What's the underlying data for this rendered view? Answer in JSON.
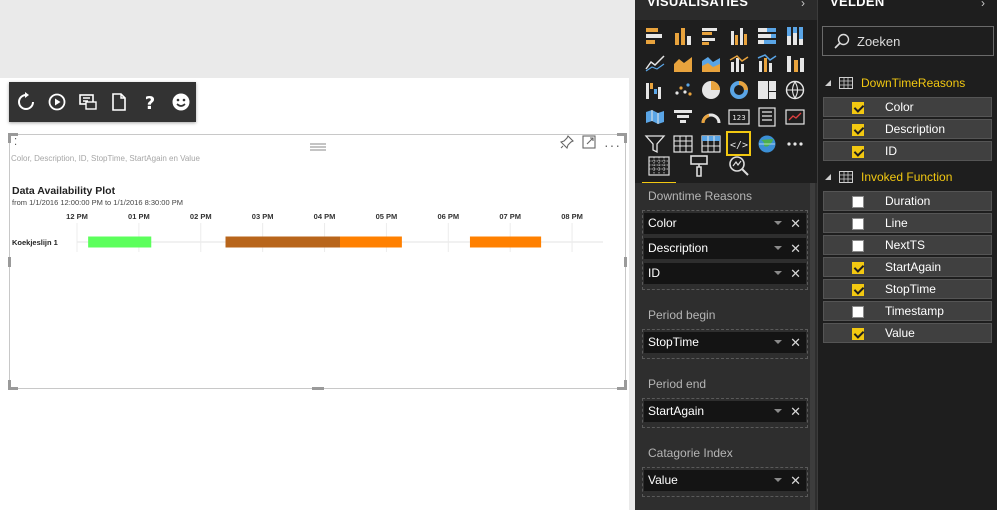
{
  "canvas": {
    "visual": {
      "tooltip_fields": "Color, Description, ID, StopTime, StartAgain en Value",
      "title": "Data Availability Plot",
      "subtitle": "from 1/1/2016 12:00:00 PM to 1/1/2016 8:30:00 PM"
    },
    "toolbar": [
      "refresh-icon",
      "play-icon",
      "chat-icon",
      "export-icon",
      "help-icon",
      "smiley-icon"
    ]
  },
  "chart_data": {
    "type": "bar",
    "title": "Data Availability Plot",
    "subtitle": "from 1/1/2016 12:00:00 PM to 1/1/2016 8:30:00 PM",
    "tick_labels": [
      "12 PM",
      "01 PM",
      "02 PM",
      "03 PM",
      "04 PM",
      "05 PM",
      "06 PM",
      "07 PM",
      "08 PM"
    ],
    "x_range_hours": [
      12.0,
      20.5
    ],
    "categories": [
      "Koekjeslijn 1"
    ],
    "segments": [
      {
        "category": "Koekjeslijn 1",
        "start": 12.18,
        "end": 13.2,
        "color": "#5cff5c"
      },
      {
        "category": "Koekjeslijn 1",
        "start": 14.4,
        "end": 16.25,
        "color": "#b8651b"
      },
      {
        "category": "Koekjeslijn 1",
        "start": 16.25,
        "end": 17.25,
        "color": "#ff8000"
      },
      {
        "category": "Koekjeslijn 1",
        "start": 18.35,
        "end": 19.5,
        "color": "#ff8000"
      }
    ]
  },
  "visualisaties": {
    "title": "VISUALISATIES",
    "icons": [
      "stacked-bar-icon",
      "stacked-column-icon",
      "clustered-bar-icon",
      "clustered-column-icon",
      "100-bar-icon",
      "100-column-icon",
      "line-chart-icon",
      "area-chart-icon",
      "stacked-area-icon",
      "line-column-icon",
      "line-stacked-column-icon",
      "ribbon-chart-icon",
      "waterfall-icon",
      "scatter-icon",
      "pie-icon",
      "donut-icon",
      "treemap-icon",
      "map-icon",
      "filled-map-icon",
      "funnel-icon",
      "gauge-icon",
      "card-icon",
      "multirow-card-icon",
      "kpi-icon",
      "slicer-icon",
      "table-icon",
      "matrix-icon",
      "custom-visual-icon",
      "globe-icon",
      "more-icon"
    ],
    "tabs": [
      "fields-tab-icon",
      "format-tab-icon",
      "analytics-tab-icon"
    ],
    "wells": [
      {
        "label": "Downtime Reasons",
        "items": [
          "Color",
          "Description",
          "ID"
        ]
      },
      {
        "label": "Period begin",
        "items": [
          "StopTime"
        ]
      },
      {
        "label": "Period end",
        "items": [
          "StartAgain"
        ]
      },
      {
        "label": "Catagorie Index",
        "items": [
          "Value"
        ]
      }
    ]
  },
  "velden": {
    "title": "VELDEN",
    "search_placeholder": "Zoeken",
    "tables": [
      {
        "name": "DownTimeReasons",
        "fields": [
          {
            "name": "Color",
            "checked": true
          },
          {
            "name": "Description",
            "checked": true
          },
          {
            "name": "ID",
            "checked": true
          }
        ]
      },
      {
        "name": "Invoked Function",
        "fields": [
          {
            "name": "Duration",
            "checked": false
          },
          {
            "name": "Line",
            "checked": false
          },
          {
            "name": "NextTS",
            "checked": false
          },
          {
            "name": "StartAgain",
            "checked": true
          },
          {
            "name": "StopTime",
            "checked": true
          },
          {
            "name": "Timestamp",
            "checked": false
          },
          {
            "name": "Value",
            "checked": true
          }
        ]
      }
    ]
  },
  "colors": {
    "accent": "#f2c811",
    "pane_dark": "#1e1e1e",
    "well_item": "#141414"
  }
}
